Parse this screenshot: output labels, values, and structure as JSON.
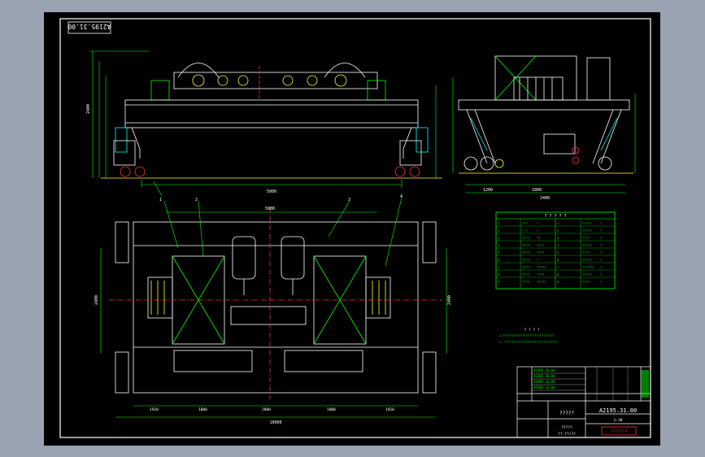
{
  "drawing": {
    "stamp_text": "A2195.31.00",
    "title_block": {
      "drawing_number": "A2195.31.00",
      "title": "?????",
      "sub_label_1": "?????",
      "sub_label_2": "??.??/??",
      "company_label": "???????",
      "part_rows": [
        "A2195.31.01",
        "A2195.31.02",
        "A2195.31.03",
        "A2195.31.04"
      ],
      "scale_label": "1:30"
    },
    "tech_notes": {
      "heading": "? ? ? ?",
      "lines": [
        "1.?????????????????????????????",
        "2. ??????????????????????????????"
      ]
    },
    "spec_table": {
      "heading": "? ? ? ? ?",
      "rows": [
        [
          "1",
          "???",
          "?",
          "1",
          "?????",
          "?"
        ],
        [
          "2",
          "?.?",
          "?",
          "2",
          "?????",
          "?"
        ],
        [
          "3",
          "????",
          "??",
          "3",
          "????",
          "?"
        ],
        [
          "4",
          "????",
          "????",
          "4",
          "?????",
          "?"
        ],
        [
          "5",
          "????",
          "????",
          "5",
          "????",
          "?"
        ],
        [
          "6",
          "????",
          "?",
          "6",
          "?????",
          "?"
        ],
        [
          "7",
          "????",
          "?????",
          "7",
          "??????",
          "?"
        ],
        [
          "8",
          "????",
          "????",
          "8",
          "?????",
          "?"
        ],
        [
          "9",
          "????",
          "?????",
          "9",
          "????",
          "?"
        ]
      ]
    },
    "dimensions": {
      "front_span": "5000",
      "plan_width": "5000",
      "plan_total": "10000",
      "plan_sub": [
        "1920",
        "1800",
        "2800",
        "1800",
        "1920"
      ],
      "side_base": "2400",
      "side_a": "1200",
      "side_b": "1800",
      "front_height": "2400",
      "plan_height": "2400",
      "plan_left": "2400"
    },
    "balloons": [
      "1",
      "2",
      "3",
      "4"
    ]
  }
}
